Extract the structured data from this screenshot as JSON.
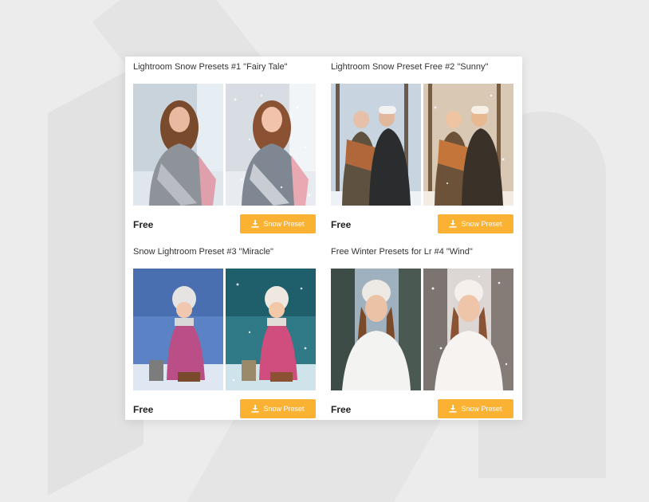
{
  "cards": [
    {
      "title": "Lightroom Snow Presets #1 \"Fairy Tale\"",
      "price": "Free",
      "button": "Snow Preset"
    },
    {
      "title": "Lightroom Snow Preset Free #2 \"Sunny\"",
      "price": "Free",
      "button": "Snow Preset"
    },
    {
      "title": "Snow Lightroom Preset #3 \"Miracle\"",
      "price": "Free",
      "button": "Snow Preset"
    },
    {
      "title": "Free Winter Presets for Lr #4 \"Wind\"",
      "price": "Free",
      "button": "Snow Preset"
    }
  ],
  "colors": {
    "accent": "#fbb131",
    "panel": "#ffffff",
    "background": "#ececec"
  },
  "icons": {
    "download": "download-icon"
  }
}
